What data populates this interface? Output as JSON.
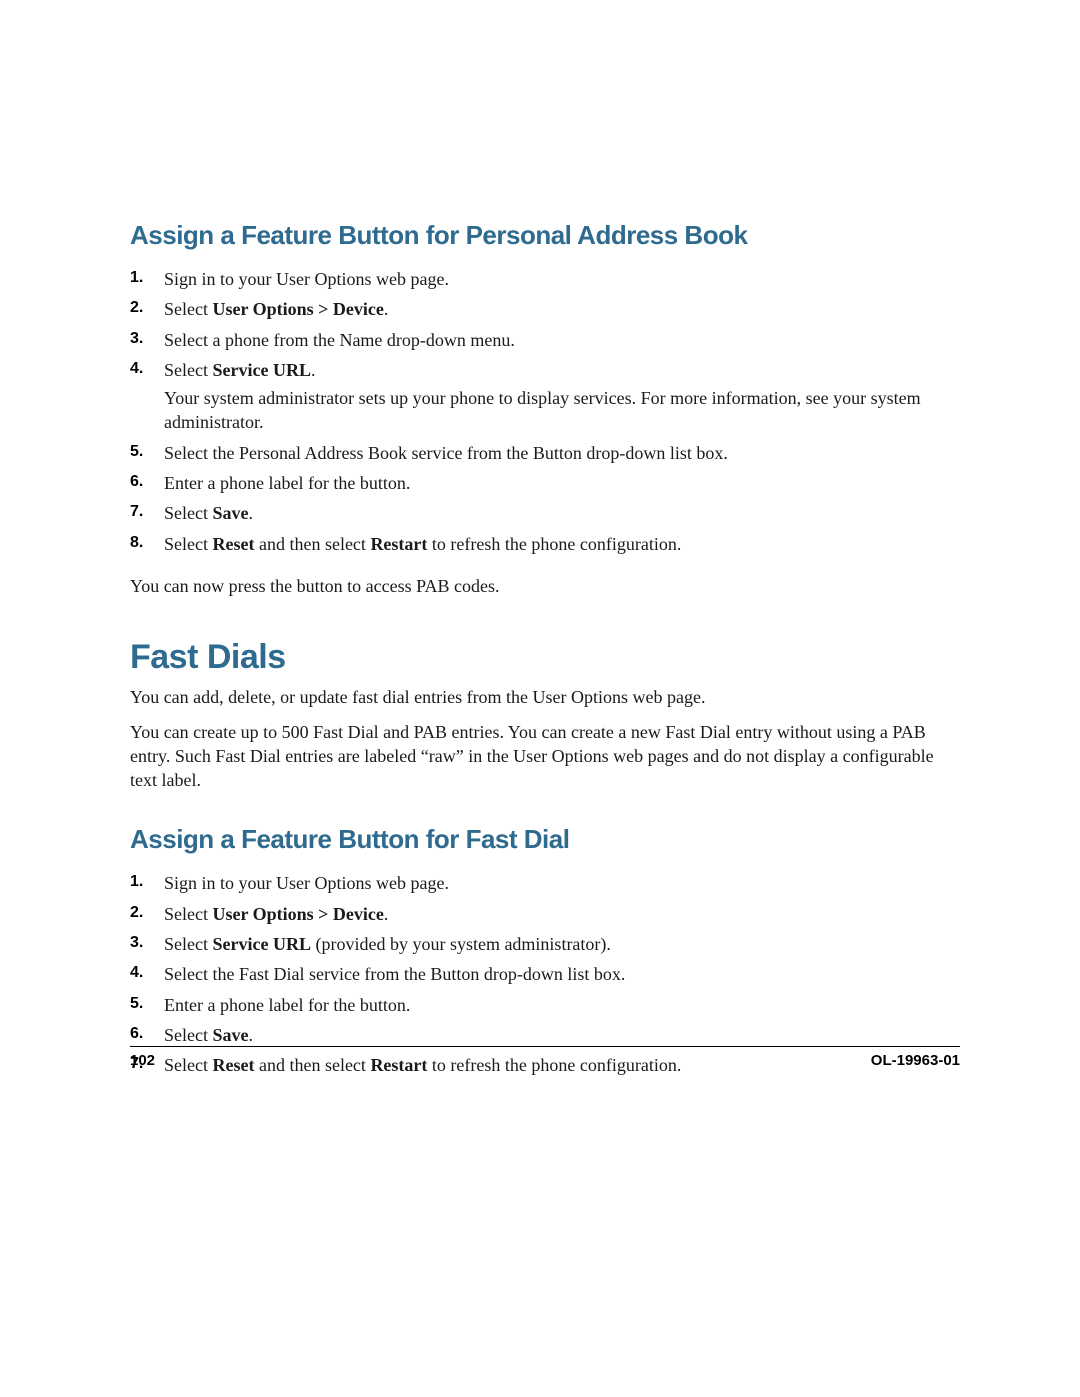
{
  "sections": {
    "pab": {
      "title": "Assign a Feature Button for Personal Address Book",
      "steps": {
        "s1": "Sign in to your User Options web page.",
        "s2_pre": "Select ",
        "s2_bold": "User Options > Device",
        "s2_post": ".",
        "s3": "Select a phone from the Name drop-down menu.",
        "s4_pre": "Select ",
        "s4_bold": "Service URL",
        "s4_post": ".",
        "s4_note": "Your system administrator sets up your phone to display services. For more information, see your system administrator.",
        "s5": "Select the Personal Address Book service from the Button drop-down list box.",
        "s6": "Enter a phone label for the button.",
        "s7_pre": "Select ",
        "s7_bold": "Save",
        "s7_post": ".",
        "s8_pre": "Select ",
        "s8_bold1": "Reset",
        "s8_mid": " and then select ",
        "s8_bold2": "Restart",
        "s8_post": " to refresh the phone configuration."
      },
      "after": "You can now press the button to access PAB codes."
    },
    "fastdials": {
      "title": "Fast Dials",
      "para1": "You can add, delete, or update fast dial entries from the User Options web page.",
      "para2": "You can create up to 500 Fast Dial and PAB entries. You can create a new Fast Dial entry without using a PAB entry. Such Fast Dial entries are labeled “raw” in the User Options web pages and do not display a configurable text label.",
      "sub": {
        "title": "Assign a Feature Button for Fast Dial",
        "steps": {
          "s1": "Sign in to your User Options web page.",
          "s2_pre": "Select ",
          "s2_bold": "User Options > Device",
          "s2_post": ".",
          "s3_pre": "Select ",
          "s3_bold": "Service URL",
          "s3_post": " (provided by your system administrator).",
          "s4": "Select the Fast Dial service from the Button drop-down list box.",
          "s5": "Enter a phone label for the button.",
          "s6_pre": "Select ",
          "s6_bold": "Save",
          "s6_post": ".",
          "s7_pre": "Select ",
          "s7_bold1": "Reset",
          "s7_mid": " and then select ",
          "s7_bold2": "Restart",
          "s7_post": " to refresh the phone configuration."
        }
      }
    }
  },
  "footer": {
    "page_number": "102",
    "doc_id": "OL-19963-01"
  }
}
